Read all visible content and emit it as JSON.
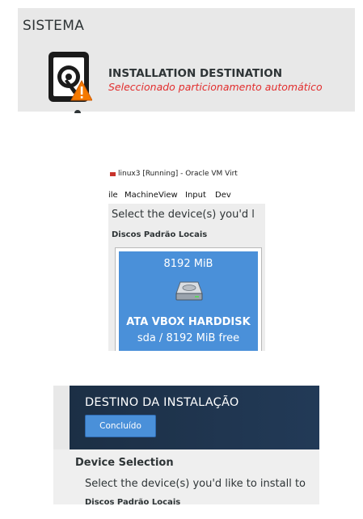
{
  "summary_hub": {
    "section_title": "SISTEMA",
    "spoke": {
      "title": "INSTALLATION DESTINATION",
      "status": "Seleccionado particionamento automático",
      "icon": "hard-disk-warning-icon"
    }
  },
  "virtualbox": {
    "window_title": "linux3 [Running] - Oracle VM Virt",
    "menu": [
      "ile",
      "Machine",
      "View",
      "Input",
      "Dev"
    ],
    "prompt": "Select the device(s) you'd l",
    "disks_label": "Discos Padrão Locais",
    "disk": {
      "size": "8192 MiB",
      "model": "ATA VBOX HARDDISK",
      "info": "sda  /  8192 MiB free",
      "icon": "hard-drive-icon",
      "selected_color": "#4a90d9"
    }
  },
  "destination_spoke": {
    "title": "DESTINO DA INSTALAÇÃO",
    "done_label": "Concluído",
    "section_title": "Device Selection",
    "prompt": "Select the device(s) you'd like to install to",
    "disks_label": "Discos Padrão Locais",
    "accent": "#4a90d9",
    "header_color": "#1c2f45"
  }
}
